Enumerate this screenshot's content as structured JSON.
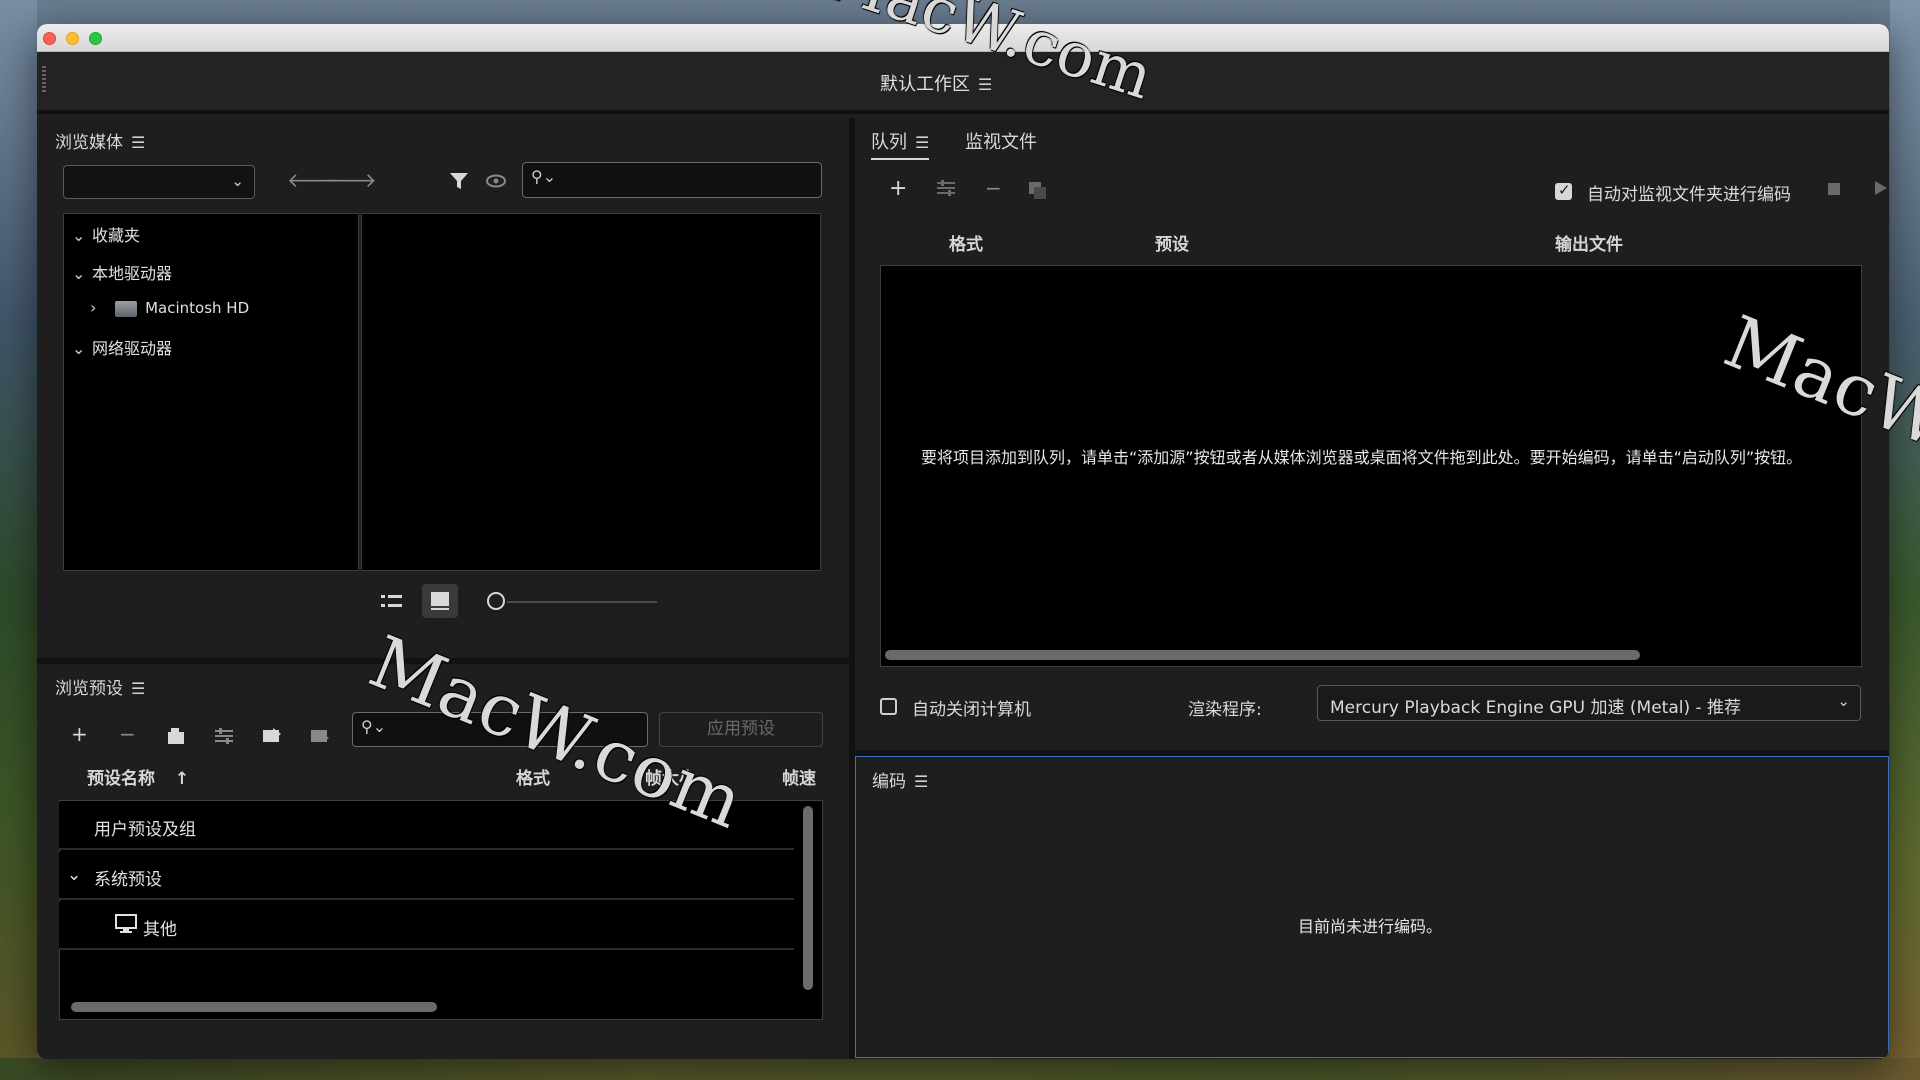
{
  "workspace": {
    "title": "默认工作区"
  },
  "media_browser": {
    "title": "浏览媒体",
    "dropdown_value": "",
    "search_placeholder": "",
    "tree": {
      "favorites": "收藏夹",
      "local_drives": "本地驱动器",
      "macintosh_hd": "Macintosh HD",
      "network_drives": "网络驱动器"
    }
  },
  "preset_browser": {
    "title": "浏览预设",
    "search_placeholder": "",
    "apply_label": "应用预设",
    "columns": {
      "name": "预设名称",
      "format": "格式",
      "frame_size": "帧大小",
      "frame_rate": "帧速"
    },
    "rows": {
      "user_presets": "用户预设及组",
      "system_presets": "系统预设",
      "other": "其他"
    }
  },
  "queue": {
    "tab_queue": "队列",
    "tab_watch": "监视文件",
    "auto_encode_label": "自动对监视文件夹进行编码",
    "auto_encode_checked": true,
    "columns": {
      "format": "格式",
      "preset": "预设",
      "output": "输出文件"
    },
    "empty_message": "要将项目添加到队列，请单击“添加源”按钮或者从媒体浏览器或桌面将文件拖到此处。要开始编码，请单击“启动队列”按钮。",
    "auto_shutdown_label": "自动关闭计算机",
    "auto_shutdown_checked": false,
    "renderer_label": "渲染程序:",
    "renderer_value": "Mercury Playback Engine GPU 加速 (Metal) - 推荐"
  },
  "encoding": {
    "title": "编码",
    "empty_message": "目前尚未进行编码。"
  },
  "watermark_text": "MacW.com"
}
